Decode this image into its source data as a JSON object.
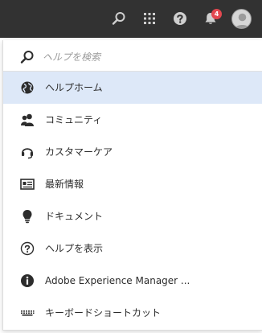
{
  "topbar": {
    "icons": [
      "search-icon",
      "apps-grid-icon",
      "help-icon",
      "notifications-bell-icon",
      "user-avatar-icon"
    ],
    "notification_count": "4",
    "colors": {
      "background": "#323232",
      "icon": "#d0d0d0",
      "badge": "#e34850"
    }
  },
  "help_panel": {
    "search_placeholder": "ヘルプを検索",
    "items": [
      {
        "label": "ヘルプホーム",
        "icon": "globe-icon",
        "active": true
      },
      {
        "label": "コミュニティ",
        "icon": "users-icon",
        "active": false
      },
      {
        "label": "カスタマーケア",
        "icon": "headset-icon",
        "active": false
      },
      {
        "label": "最新情報",
        "icon": "news-icon",
        "active": false
      },
      {
        "label": "ドキュメント",
        "icon": "lightbulb-icon",
        "active": false
      },
      {
        "label": "ヘルプを表示",
        "icon": "question-circle-icon",
        "active": false
      },
      {
        "label": "Adobe Experience Manager ...",
        "icon": "info-icon",
        "active": false
      },
      {
        "label": "キーボードショートカット",
        "icon": "keyboard-icon",
        "active": false
      }
    ],
    "colors": {
      "active_background": "#dde8f8",
      "text": "#2c2c2c",
      "icon": "#2c2c2c"
    }
  }
}
